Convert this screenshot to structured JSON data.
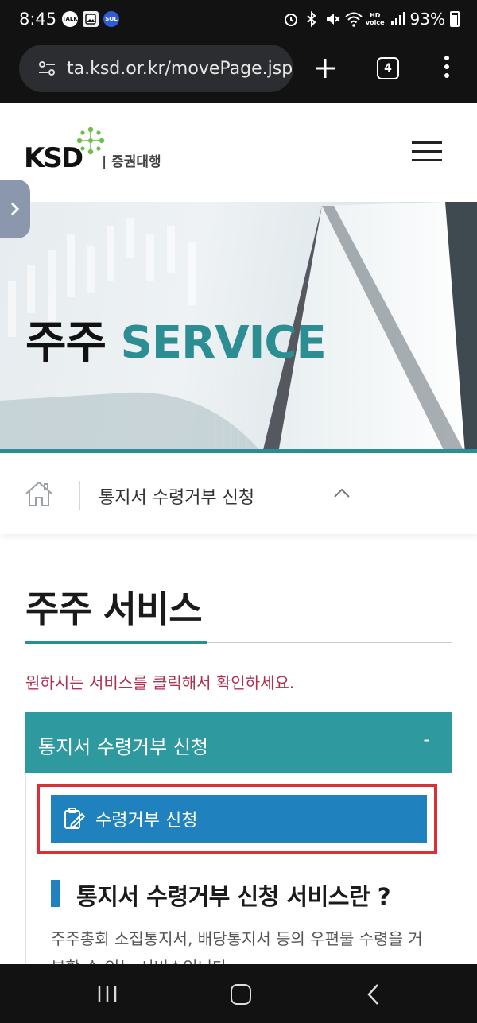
{
  "status_bar": {
    "time": "8:45",
    "app_badges": [
      "TALK",
      "",
      "SOL"
    ],
    "hd_voice": "HD\nvoice",
    "battery": "93%"
  },
  "browser": {
    "url": "ta.ksd.or.kr/movePage.jsp",
    "tab_count": "4"
  },
  "header": {
    "logo_text": "KSD",
    "logo_sub": "| 증권대행"
  },
  "hero": {
    "title_ko": "주주",
    "title_en": "SERVICE"
  },
  "breadcrumb": {
    "current": "통지서 수령거부 신청"
  },
  "content": {
    "page_title": "주주 서비스",
    "notice": "원하시는 서비스를 클릭해서 확인하세요.",
    "accordion": {
      "label": "통지서 수령거부 신청",
      "toggle": "-"
    },
    "apply_button": "수령거부 신청",
    "section_title": "통지서 수령거부 신청 서비스란 ?",
    "description": "주주총회 소집통지서, 배당통지서 등의 우편물 수령을 거부할 수 있는 서비스입니다."
  },
  "colors": {
    "teal": "#2e9aa0",
    "blue": "#1f82bf",
    "notice_red": "#b0304e",
    "highlight": "#dc2f35"
  }
}
